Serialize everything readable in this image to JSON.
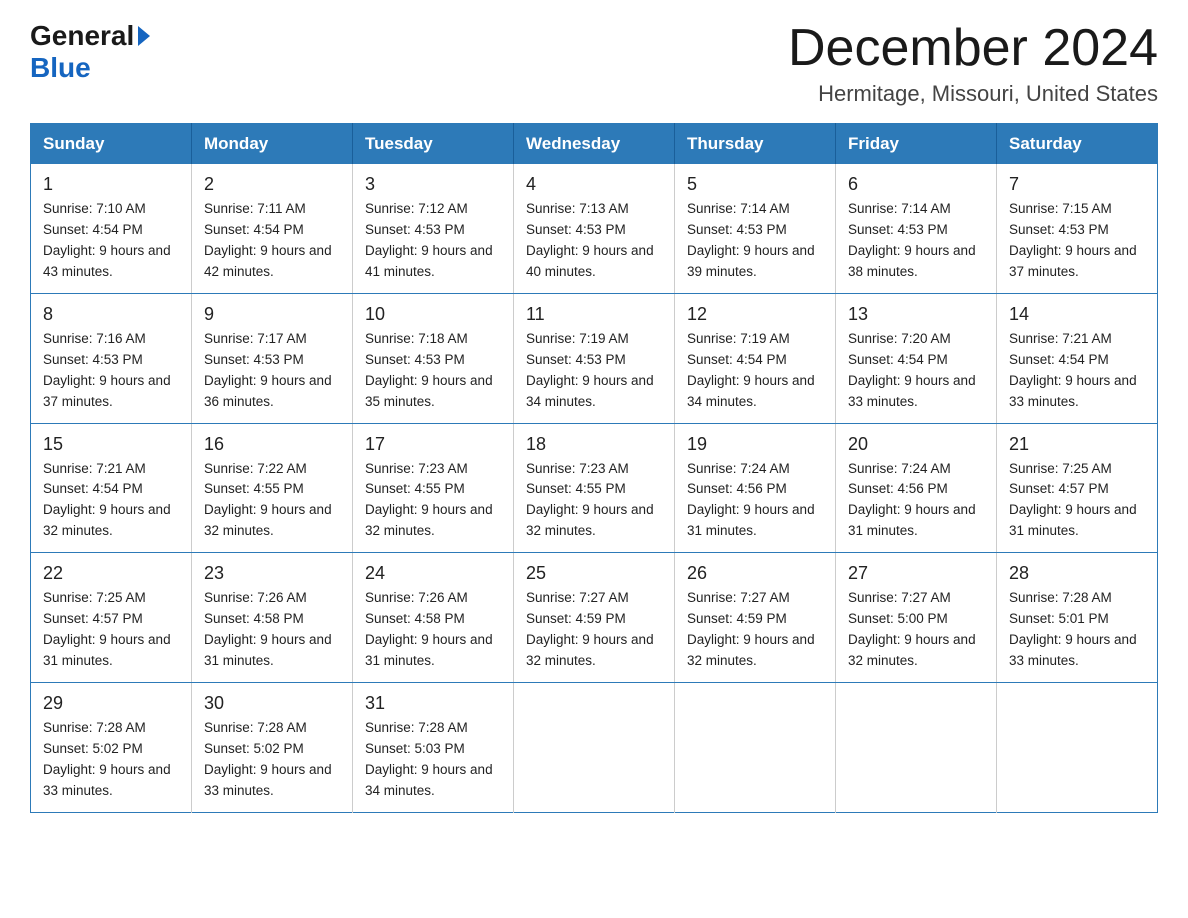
{
  "header": {
    "logo_general": "General",
    "logo_blue": "Blue",
    "title": "December 2024",
    "subtitle": "Hermitage, Missouri, United States"
  },
  "calendar": {
    "days_of_week": [
      "Sunday",
      "Monday",
      "Tuesday",
      "Wednesday",
      "Thursday",
      "Friday",
      "Saturday"
    ],
    "weeks": [
      [
        {
          "day": "1",
          "sunrise": "7:10 AM",
          "sunset": "4:54 PM",
          "daylight": "9 hours and 43 minutes."
        },
        {
          "day": "2",
          "sunrise": "7:11 AM",
          "sunset": "4:54 PM",
          "daylight": "9 hours and 42 minutes."
        },
        {
          "day": "3",
          "sunrise": "7:12 AM",
          "sunset": "4:53 PM",
          "daylight": "9 hours and 41 minutes."
        },
        {
          "day": "4",
          "sunrise": "7:13 AM",
          "sunset": "4:53 PM",
          "daylight": "9 hours and 40 minutes."
        },
        {
          "day": "5",
          "sunrise": "7:14 AM",
          "sunset": "4:53 PM",
          "daylight": "9 hours and 39 minutes."
        },
        {
          "day": "6",
          "sunrise": "7:14 AM",
          "sunset": "4:53 PM",
          "daylight": "9 hours and 38 minutes."
        },
        {
          "day": "7",
          "sunrise": "7:15 AM",
          "sunset": "4:53 PM",
          "daylight": "9 hours and 37 minutes."
        }
      ],
      [
        {
          "day": "8",
          "sunrise": "7:16 AM",
          "sunset": "4:53 PM",
          "daylight": "9 hours and 37 minutes."
        },
        {
          "day": "9",
          "sunrise": "7:17 AM",
          "sunset": "4:53 PM",
          "daylight": "9 hours and 36 minutes."
        },
        {
          "day": "10",
          "sunrise": "7:18 AM",
          "sunset": "4:53 PM",
          "daylight": "9 hours and 35 minutes."
        },
        {
          "day": "11",
          "sunrise": "7:19 AM",
          "sunset": "4:53 PM",
          "daylight": "9 hours and 34 minutes."
        },
        {
          "day": "12",
          "sunrise": "7:19 AM",
          "sunset": "4:54 PM",
          "daylight": "9 hours and 34 minutes."
        },
        {
          "day": "13",
          "sunrise": "7:20 AM",
          "sunset": "4:54 PM",
          "daylight": "9 hours and 33 minutes."
        },
        {
          "day": "14",
          "sunrise": "7:21 AM",
          "sunset": "4:54 PM",
          "daylight": "9 hours and 33 minutes."
        }
      ],
      [
        {
          "day": "15",
          "sunrise": "7:21 AM",
          "sunset": "4:54 PM",
          "daylight": "9 hours and 32 minutes."
        },
        {
          "day": "16",
          "sunrise": "7:22 AM",
          "sunset": "4:55 PM",
          "daylight": "9 hours and 32 minutes."
        },
        {
          "day": "17",
          "sunrise": "7:23 AM",
          "sunset": "4:55 PM",
          "daylight": "9 hours and 32 minutes."
        },
        {
          "day": "18",
          "sunrise": "7:23 AM",
          "sunset": "4:55 PM",
          "daylight": "9 hours and 32 minutes."
        },
        {
          "day": "19",
          "sunrise": "7:24 AM",
          "sunset": "4:56 PM",
          "daylight": "9 hours and 31 minutes."
        },
        {
          "day": "20",
          "sunrise": "7:24 AM",
          "sunset": "4:56 PM",
          "daylight": "9 hours and 31 minutes."
        },
        {
          "day": "21",
          "sunrise": "7:25 AM",
          "sunset": "4:57 PM",
          "daylight": "9 hours and 31 minutes."
        }
      ],
      [
        {
          "day": "22",
          "sunrise": "7:25 AM",
          "sunset": "4:57 PM",
          "daylight": "9 hours and 31 minutes."
        },
        {
          "day": "23",
          "sunrise": "7:26 AM",
          "sunset": "4:58 PM",
          "daylight": "9 hours and 31 minutes."
        },
        {
          "day": "24",
          "sunrise": "7:26 AM",
          "sunset": "4:58 PM",
          "daylight": "9 hours and 31 minutes."
        },
        {
          "day": "25",
          "sunrise": "7:27 AM",
          "sunset": "4:59 PM",
          "daylight": "9 hours and 32 minutes."
        },
        {
          "day": "26",
          "sunrise": "7:27 AM",
          "sunset": "4:59 PM",
          "daylight": "9 hours and 32 minutes."
        },
        {
          "day": "27",
          "sunrise": "7:27 AM",
          "sunset": "5:00 PM",
          "daylight": "9 hours and 32 minutes."
        },
        {
          "day": "28",
          "sunrise": "7:28 AM",
          "sunset": "5:01 PM",
          "daylight": "9 hours and 33 minutes."
        }
      ],
      [
        {
          "day": "29",
          "sunrise": "7:28 AM",
          "sunset": "5:02 PM",
          "daylight": "9 hours and 33 minutes."
        },
        {
          "day": "30",
          "sunrise": "7:28 AM",
          "sunset": "5:02 PM",
          "daylight": "9 hours and 33 minutes."
        },
        {
          "day": "31",
          "sunrise": "7:28 AM",
          "sunset": "5:03 PM",
          "daylight": "9 hours and 34 minutes."
        },
        null,
        null,
        null,
        null
      ]
    ]
  }
}
